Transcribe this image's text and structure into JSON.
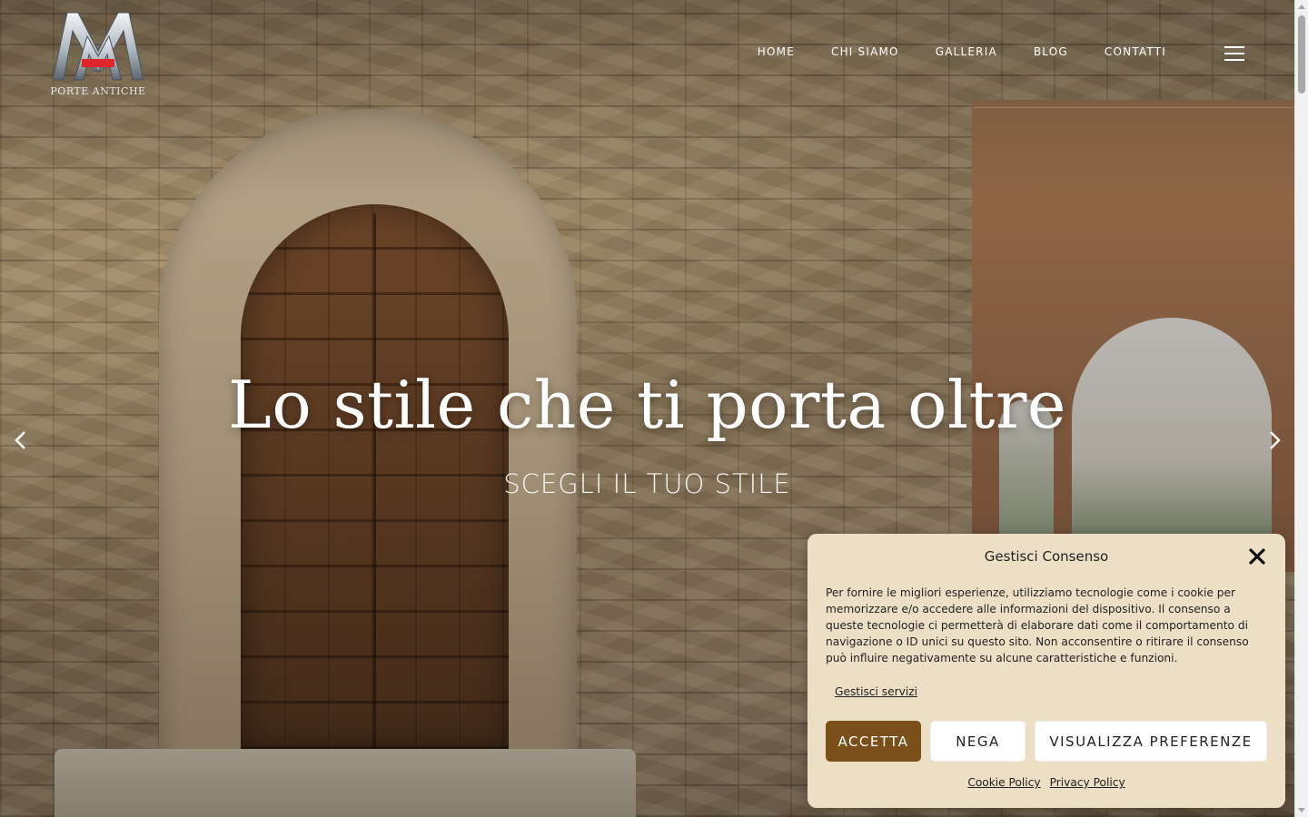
{
  "header": {
    "logo_text": "PORTE ANTICHE",
    "nav": [
      "HOME",
      "CHI SIAMO",
      "GALLERIA",
      "BLOG",
      "CONTATTI"
    ]
  },
  "hero": {
    "title": "Lo stile che ti porta oltre",
    "subtitle": "SCEGLI IL TUO STILE"
  },
  "consent": {
    "title": "Gestisci Consenso",
    "text": "Per fornire le migliori esperienze, utilizziamo tecnologie come i cookie per memorizzare e/o accedere alle informazioni del dispositivo. Il consenso a queste tecnologie ci permetterà di elaborare dati come il comportamento di navigazione o ID unici su questo sito. Non acconsentire o ritirare il consenso può influire negativamente su alcune caratteristiche e funzioni.",
    "manage_services": "Gestisci servizi",
    "accept_label": "ACCETTA",
    "deny_label": "NEGA",
    "preferences_label": "VISUALIZZA PREFERENZE",
    "cookie_policy": "Cookie Policy",
    "privacy_policy": "Privacy Policy"
  },
  "icons": {
    "menu": "hamburger-menu-icon",
    "prev": "chevron-left-icon",
    "next": "chevron-right-icon",
    "close": "close-icon"
  },
  "colors": {
    "accent": "#7a4f1a",
    "consent_bg": "#eddfc5",
    "logo_red": "#e0252b"
  }
}
